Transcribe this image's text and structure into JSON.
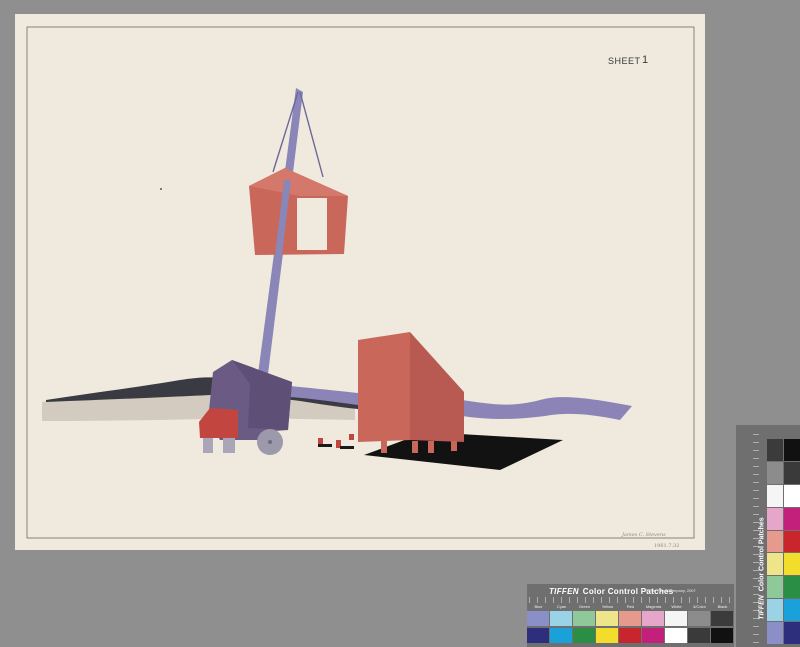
{
  "sheet": {
    "label": "SHEET",
    "number": "1",
    "signature": "James C. Stevens",
    "catalog_mark": "1961.7.32"
  },
  "color_card_bottom": {
    "brand": "TIFFEN",
    "title": "Color Control Patches",
    "subtitle": "© The Tiffen Company, 2007",
    "patch_labels": [
      "Blue",
      "Cyan",
      "Green",
      "Yellow",
      "Red",
      "Magenta",
      "White",
      "3/Color",
      "Black"
    ],
    "top_row_colors": [
      "#8a8fc8",
      "#9ad2e6",
      "#8fc99a",
      "#eee48a",
      "#e69a8e",
      "#e5a6c9",
      "#f5f5f5",
      "#8c8c8c",
      "#3b3b3b"
    ],
    "bottom_row_colors": [
      "#2d2f7c",
      "#1aa1d9",
      "#2a8f45",
      "#f2dd2c",
      "#c8262c",
      "#c2207a",
      "#ffffff",
      "#3a3a3a",
      "#111111"
    ]
  },
  "color_card_right": {
    "brand": "TIFFEN",
    "title": "Color Control Patches",
    "patch_labels": [
      "Blue",
      "Cyan",
      "Green",
      "Yellow",
      "Red",
      "Magenta",
      "White",
      "3/Color",
      "Black"
    ],
    "column_left_colors": [
      "#3b3b3b",
      "#8c8c8c",
      "#f5f5f5",
      "#e5a6c9",
      "#e69a8e",
      "#eee48a",
      "#8fc99a",
      "#9ad2e6",
      "#8a8fc8"
    ],
    "column_right_colors": [
      "#111111",
      "#3a3a3a",
      "#ffffff",
      "#c2207a",
      "#c8262c",
      "#f2dd2c",
      "#2a8f45",
      "#1aa1d9",
      "#2d2f7c"
    ]
  },
  "palette": {
    "background": "#8e8f8e",
    "paper": "#efeadd",
    "salmon": "#c8675a",
    "lavender": "#8c84b6",
    "purple": "#6b5a84",
    "charcoal": "#3a3a42",
    "shadow": "#121212",
    "taupe": "#d3cbbf"
  }
}
